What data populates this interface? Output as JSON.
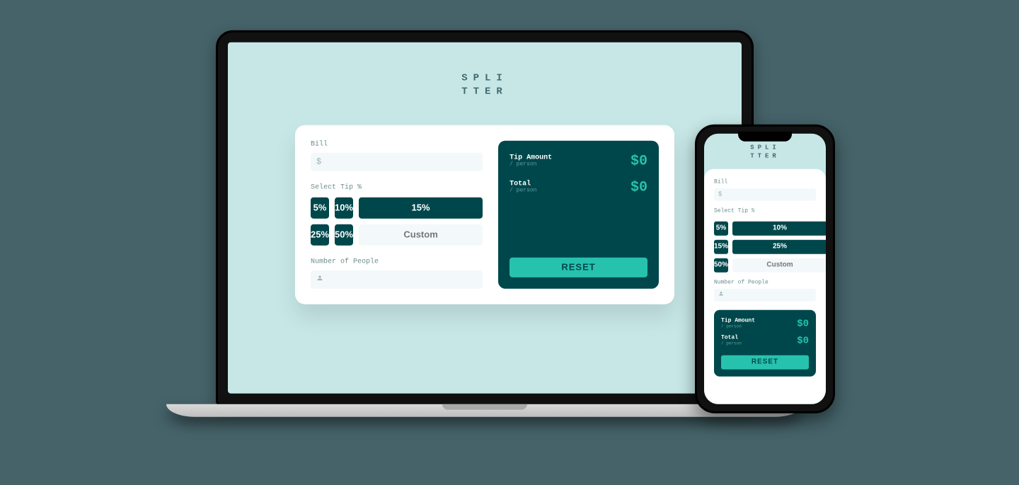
{
  "logo": {
    "line1": "SPLI",
    "line2": "TTER"
  },
  "form": {
    "bill_label": "Bill",
    "bill_placeholder": "$",
    "tip_label": "Select Tip %",
    "tip_options": [
      "5%",
      "10%",
      "15%",
      "25%",
      "50%"
    ],
    "tip_custom_placeholder": "Custom",
    "people_label": "Number of People"
  },
  "results": {
    "tip": {
      "label": "Tip Amount",
      "sub": "/ person",
      "value": "$0"
    },
    "total": {
      "label": "Total",
      "sub": "/ person",
      "value": "$0"
    },
    "reset_label": "RESET"
  }
}
